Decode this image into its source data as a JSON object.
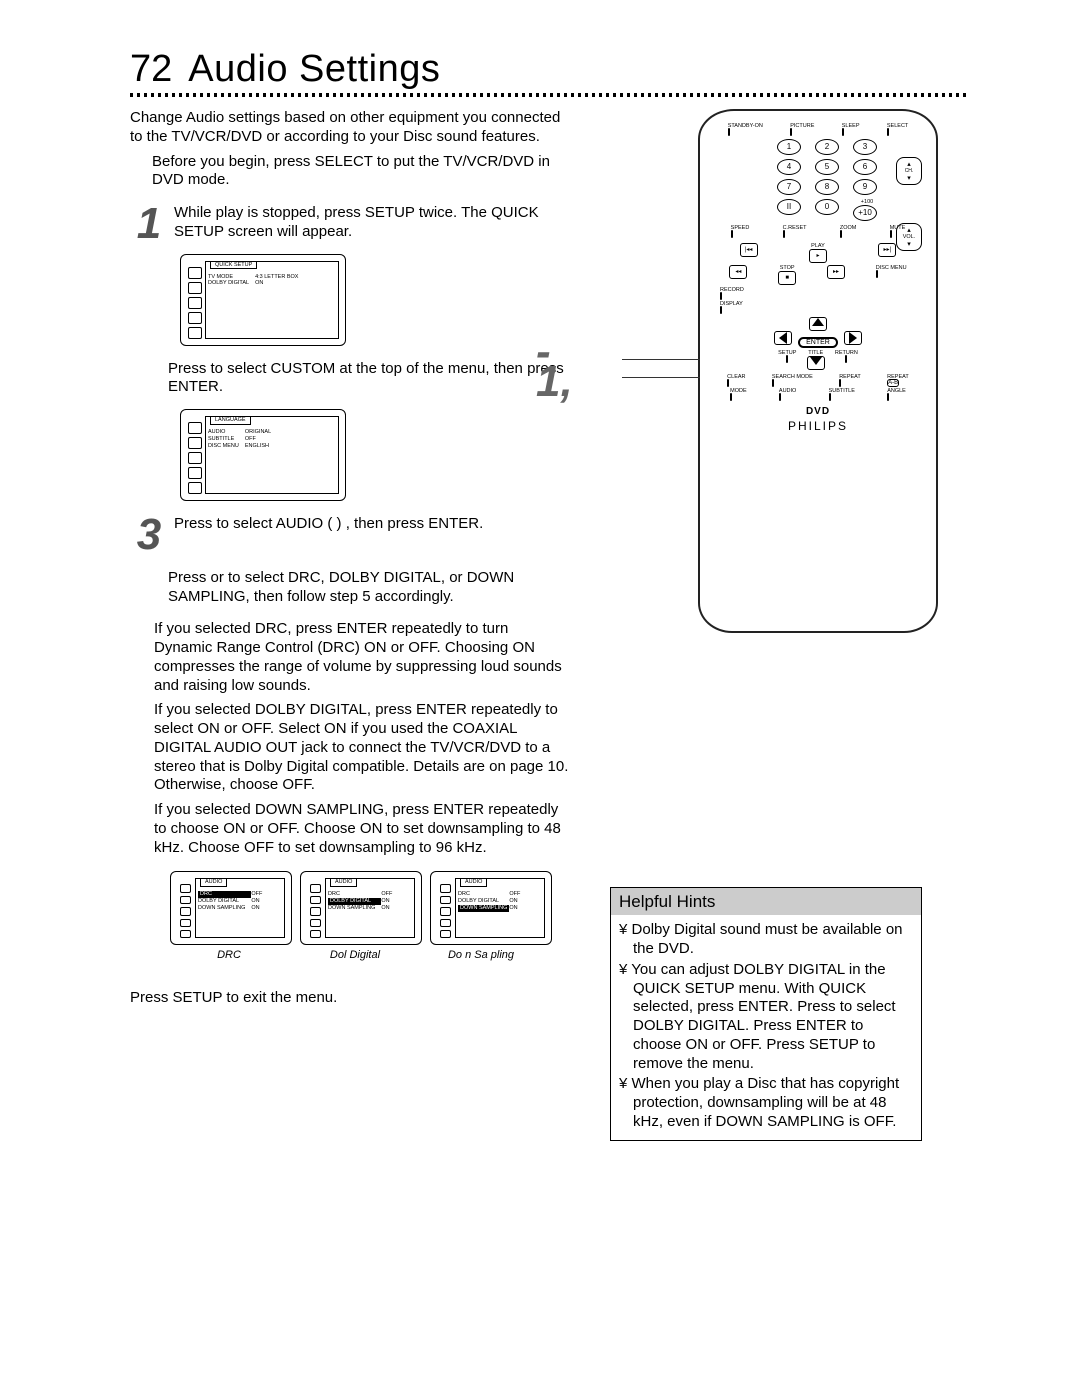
{
  "page": {
    "number": "72",
    "title": "Audio Settings"
  },
  "intro": {
    "p1": "Change Audio settings based on other equipment you connected to the TV/VCR/DVD or according to your Disc sound features.",
    "p2": "Before you begin, press SELECT to put the TV/VCR/DVD in DVD mode."
  },
  "steps": {
    "s1": {
      "num": "1",
      "text": "While play is stopped, press SETUP twice.    The QUICK SETUP screen will appear."
    },
    "s2": {
      "text": "Press     to select CUSTOM   at the top of the menu, then press ENTER."
    },
    "s3": {
      "num": "3",
      "text": "Press     to select AUDIO (        ) , then press ENTER."
    },
    "s4": {
      "text": "Press     or     to select DRC, DOLBY DIGITAL, or DOWN SAMPLING, then follow step 5 accordingly."
    },
    "s5a": "If you selected DRC, press ENTER repeatedly to turn Dynamic Range Control (DRC) ON or OFF. Choosing ON compresses the range of volume by suppressing loud sounds and raising low sounds.",
    "s5b": "If you selected DOLBY DIGITAL, press ENTER repeatedly to select ON or OFF. Select ON if you used the COAXIAL DIGITAL AUDIO OUT jack to connect the TV/VCR/DVD to a stereo that is Dolby Digital compatible. Details are on page 10. Otherwise, choose OFF.",
    "s5c": "If you selected DOWN SAMPLING, press ENTER repeatedly to choose ON or OFF. Choose ON to set downsampling to 48 kHz. Choose OFF to set downsampling to 96 kHz.",
    "exit": "Press SETUP to exit the menu."
  },
  "osd1": {
    "tab": "QUICK SETUP",
    "rows": [
      [
        "TV MODE",
        "4:3 LETTER BOX"
      ],
      [
        "DOLBY DIGITAL",
        "ON"
      ]
    ]
  },
  "osd2": {
    "tab": "LANGUAGE",
    "rows": [
      [
        "AUDIO",
        "ORIGINAL"
      ],
      [
        "SUBTITLE",
        "OFF"
      ],
      [
        "DISC MENU",
        "ENGLISH"
      ]
    ]
  },
  "osd_audio": {
    "tab": "AUDIO",
    "rows": [
      [
        "DRC",
        "OFF"
      ],
      [
        "DOLBY DIGITAL",
        "ON"
      ],
      [
        "DOWN SAMPLING",
        "ON"
      ]
    ],
    "captions": [
      "DRC",
      "Dol   Digital",
      "Do  n Sa  pling"
    ]
  },
  "remote": {
    "top": [
      "STANDBY-ON",
      "PICTURE",
      "SLEEP",
      "SELECT"
    ],
    "numbers": [
      "1",
      "2",
      "3",
      "4",
      "5",
      "6",
      "7",
      "8",
      "9"
    ],
    "num_extra": [
      "II",
      "0",
      "+10"
    ],
    "num_side": [
      "CH.",
      "+100",
      "VOL."
    ],
    "midrow": [
      "SPEED",
      "C.RESET",
      "ZOOM",
      "MUTE"
    ],
    "transport": [
      "◂◂",
      "PLAY",
      "▸▸",
      "◂◂",
      "STOP",
      "▸▸"
    ],
    "transport_right": "DISC MENU",
    "rec_row": [
      "RECORD",
      "DISPLAY"
    ],
    "enter": "ENTER",
    "row_setup": [
      "SETUP",
      "TITLE",
      "RETURN"
    ],
    "row_clear": [
      "CLEAR",
      "SEARCH MODE",
      "REPEAT",
      "REPEAT",
      "A-B"
    ],
    "row_mode": [
      "MODE",
      "AUDIO",
      "SUBTITLE",
      "ANGLE"
    ],
    "dvd": "DVD",
    "brand": "PHILIPS"
  },
  "callouts": {
    "c1": "-",
    "c2": "1,"
  },
  "hints": {
    "title": "Helpful Hints",
    "items": [
      "Dolby Digital sound must be available on the DVD.",
      "You can adjust DOLBY DIGITAL in the QUICK SETUP menu. With QUICK selected, press ENTER. Press to select DOLBY DIGITAL. Press ENTER to choose ON or OFF. Press SETUP to remove the menu.",
      "When you play a Disc that has copyright protection, downsampling will be at 48 kHz, even if DOWN SAMPLING is OFF."
    ]
  }
}
